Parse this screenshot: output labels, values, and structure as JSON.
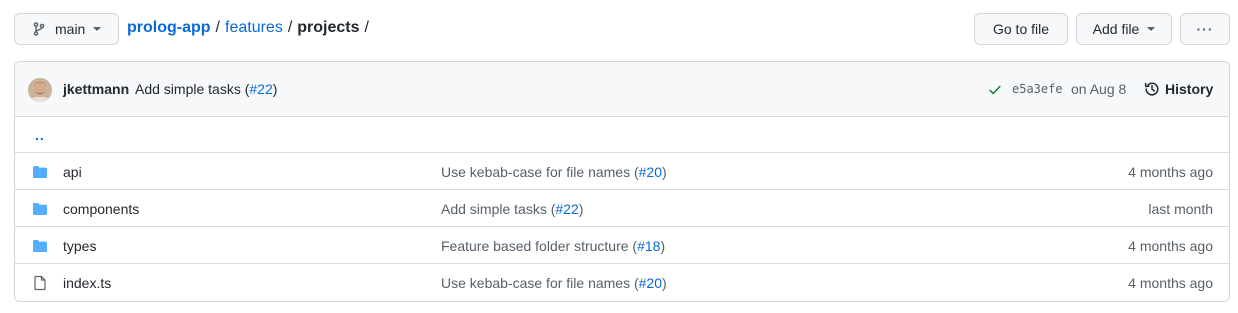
{
  "branch": {
    "name": "main",
    "icon": "git-branch-icon"
  },
  "breadcrumb": {
    "repo": "prolog-app",
    "sep": "/",
    "folder": "features",
    "current": "projects",
    "trailing": "/"
  },
  "actions": {
    "go_to_file": "Go to file",
    "add_file": "Add file",
    "more": "···"
  },
  "latest_commit": {
    "author": "jkettmann",
    "message_prefix": "Add simple tasks (",
    "pr": "#22",
    "message_suffix": ")",
    "sha": "e5a3efe",
    "date": "on Aug 8",
    "history_label": "History"
  },
  "parent_link": "..",
  "files": [
    {
      "type": "folder",
      "icon": "folder-icon",
      "name": "api",
      "msg_prefix": "Use kebab-case for file names (",
      "pr": "#20",
      "msg_suffix": ")",
      "age": "4 months ago"
    },
    {
      "type": "folder",
      "icon": "folder-icon",
      "name": "components",
      "msg_prefix": "Add simple tasks (",
      "pr": "#22",
      "msg_suffix": ")",
      "age": "last month"
    },
    {
      "type": "folder",
      "icon": "folder-icon",
      "name": "types",
      "msg_prefix": "Feature based folder structure (",
      "pr": "#18",
      "msg_suffix": ")",
      "age": "4 months ago"
    },
    {
      "type": "file",
      "icon": "file-icon",
      "name": "index.ts",
      "msg_prefix": "Use kebab-case for file names (",
      "pr": "#20",
      "msg_suffix": ")",
      "age": "4 months ago"
    }
  ],
  "colors": {
    "link": "#0969da",
    "folder": "#54aeff",
    "check": "#1a7f37",
    "muted": "#57606a"
  }
}
